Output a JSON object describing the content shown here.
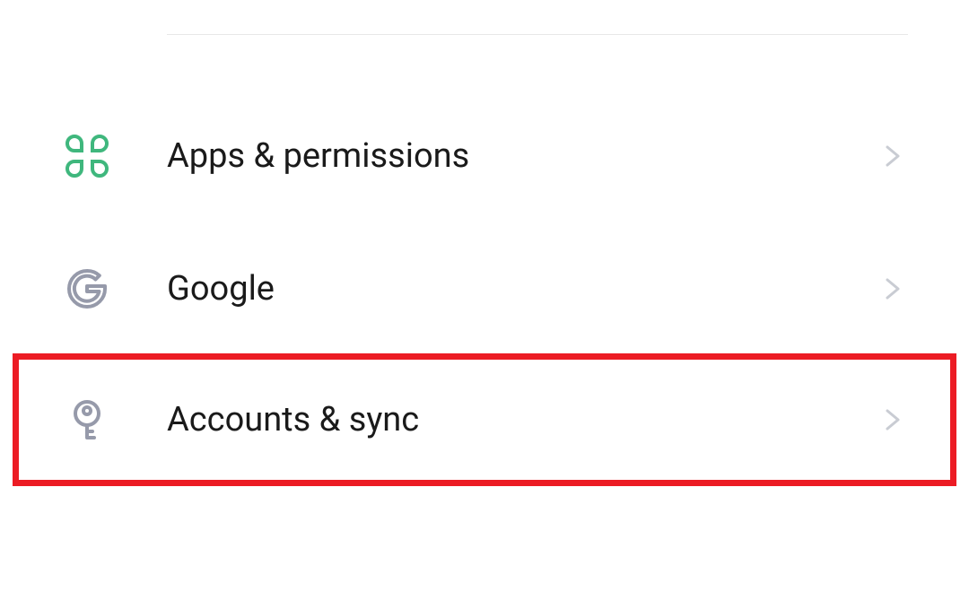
{
  "settings": {
    "items": [
      {
        "label": "Apps & permissions",
        "icon": "apps-clover-icon",
        "iconColor": "#3fb77d",
        "highlighted": false
      },
      {
        "label": "Google",
        "icon": "google-g-icon",
        "iconColor": "#969aaa",
        "highlighted": false
      },
      {
        "label": "Accounts & sync",
        "icon": "key-icon",
        "iconColor": "#969aaa",
        "highlighted": true
      }
    ],
    "chevronColor": "#c9ccd3"
  }
}
